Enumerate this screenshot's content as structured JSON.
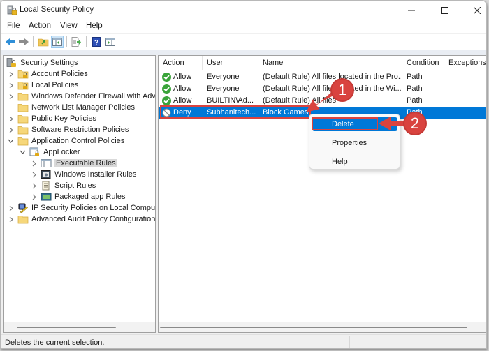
{
  "window": {
    "title": "Local Security Policy",
    "controls": {
      "minimize": "minimize-icon",
      "maximize": "maximize-icon",
      "close": "close-icon"
    }
  },
  "menubar": {
    "items": [
      {
        "label": "File"
      },
      {
        "label": "Action"
      },
      {
        "label": "View"
      },
      {
        "label": "Help"
      }
    ]
  },
  "toolbar": {
    "buttons": [
      {
        "icon": "back-arrow-icon"
      },
      {
        "icon": "forward-arrow-icon"
      },
      {
        "icon": "up-folder-icon"
      },
      {
        "icon": "show-hide-console-tree-icon",
        "active": true
      },
      {
        "icon": "export-list-icon"
      },
      {
        "icon": "help-icon"
      },
      {
        "icon": "show-hide-action-pane-icon"
      }
    ]
  },
  "tree": {
    "root": "Security Settings",
    "items": [
      {
        "label": "Account Policies",
        "level": 1,
        "expander": "collapsed",
        "icon": "locked-folder-icon"
      },
      {
        "label": "Local Policies",
        "level": 1,
        "expander": "collapsed",
        "icon": "locked-folder-icon"
      },
      {
        "label": "Windows Defender Firewall with Advanced Security",
        "level": 1,
        "expander": "collapsed",
        "icon": "folder-icon"
      },
      {
        "label": "Network List Manager Policies",
        "level": 1,
        "expander": "none",
        "icon": "folder-icon"
      },
      {
        "label": "Public Key Policies",
        "level": 1,
        "expander": "collapsed",
        "icon": "folder-icon"
      },
      {
        "label": "Software Restriction Policies",
        "level": 1,
        "expander": "collapsed",
        "icon": "folder-icon"
      },
      {
        "label": "Application Control Policies",
        "level": 1,
        "expander": "expanded",
        "icon": "folder-icon"
      },
      {
        "label": "AppLocker",
        "level": 2,
        "expander": "expanded",
        "icon": "applocker-icon"
      },
      {
        "label": "Executable Rules",
        "level": 3,
        "expander": "collapsed",
        "icon": "executable-rules-icon",
        "selected": true
      },
      {
        "label": "Windows Installer Rules",
        "level": 3,
        "expander": "collapsed",
        "icon": "installer-rules-icon"
      },
      {
        "label": "Script Rules",
        "level": 3,
        "expander": "collapsed",
        "icon": "script-rules-icon"
      },
      {
        "label": "Packaged app Rules",
        "level": 3,
        "expander": "collapsed",
        "icon": "packaged-app-rules-icon"
      },
      {
        "label": "IP Security Policies on Local Computer",
        "level": 1,
        "expander": "collapsed",
        "icon": "ip-security-icon"
      },
      {
        "label": "Advanced Audit Policy Configuration",
        "level": 1,
        "expander": "collapsed",
        "icon": "folder-icon"
      }
    ]
  },
  "list": {
    "columns": [
      "Action",
      "User",
      "Name",
      "Condition",
      "Exceptions"
    ],
    "rows": [
      {
        "action": "Allow",
        "icon": "allow-check-icon",
        "user": "Everyone",
        "name": "(Default Rule) All files located in the Pro...",
        "condition": "Path",
        "exceptions": ""
      },
      {
        "action": "Allow",
        "icon": "allow-check-icon",
        "user": "Everyone",
        "name": "(Default Rule) All files located in the Wi...",
        "condition": "Path",
        "exceptions": ""
      },
      {
        "action": "Allow",
        "icon": "allow-check-icon",
        "user": "BUILTIN\\Ad...",
        "name": "(Default Rule) All files",
        "condition": "Path",
        "exceptions": ""
      },
      {
        "action": "Deny",
        "icon": "deny-icon",
        "user": "Subhanitech...",
        "name": "Block Games",
        "condition": "Path",
        "exceptions": "",
        "selected": true
      }
    ]
  },
  "context_menu": {
    "items": [
      {
        "label": "Delete",
        "highlighted": true
      },
      {
        "label": "Properties"
      },
      {
        "label": "Help"
      }
    ]
  },
  "annotations": {
    "step1": "1",
    "step2": "2",
    "color": "#d9433f"
  },
  "statusbar": {
    "text": "Deletes the current selection."
  },
  "colors": {
    "selection": "#0078d7",
    "allow": "#3aa43a",
    "annotation": "#d9433f"
  }
}
